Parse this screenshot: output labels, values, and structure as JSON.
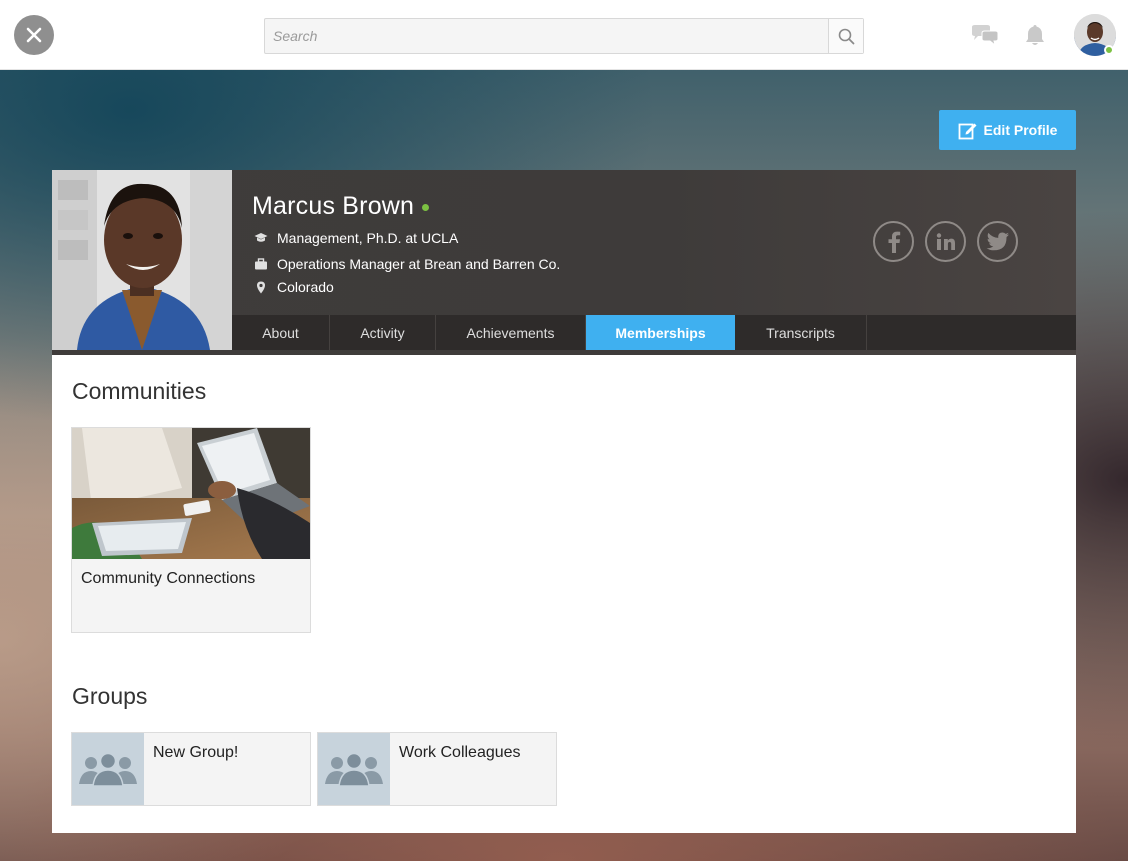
{
  "topbar": {
    "search_placeholder": "Search",
    "icons": {
      "close": "close-icon",
      "search": "search-icon",
      "chat": "chat-icon",
      "notifications": "bell-icon",
      "avatar": "user-avatar"
    },
    "online_status_color": "#7cc142"
  },
  "edit_profile": {
    "label": "Edit Profile",
    "icon": "edit-icon",
    "color": "#3fb0f0"
  },
  "profile": {
    "name": "Marcus Brown",
    "online": true,
    "education": "Management, Ph.D. at UCLA",
    "job": "Operations Manager at Brean and Barren Co.",
    "location": "Colorado",
    "social": [
      "facebook-icon",
      "linkedin-icon",
      "twitter-icon"
    ]
  },
  "tabs": [
    {
      "label": "About",
      "active": false
    },
    {
      "label": "Activity",
      "active": false
    },
    {
      "label": "Achievements",
      "active": false
    },
    {
      "label": "Memberships",
      "active": true
    },
    {
      "label": "Transcripts",
      "active": false
    }
  ],
  "communities": {
    "title": "Communities",
    "items": [
      {
        "name": "Community Connections"
      }
    ]
  },
  "groups": {
    "title": "Groups",
    "items": [
      {
        "name": "New Group!"
      },
      {
        "name": "Work Colleagues"
      }
    ]
  },
  "colors": {
    "accent": "#3fb0f0",
    "header_bg": "#3e3b3a",
    "tab_bar_bg": "#2e2b2a",
    "group_thumb_bg": "#c7d3dc"
  }
}
